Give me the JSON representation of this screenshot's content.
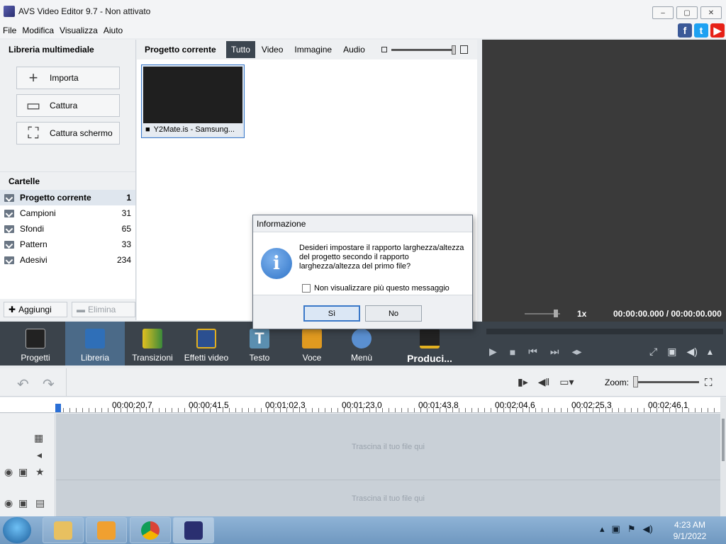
{
  "window": {
    "title": "AVS Video Editor 9.7 - Non attivato"
  },
  "menu": [
    "File",
    "Modifica",
    "Visualizza",
    "Aiuto"
  ],
  "library": {
    "title": "Libreria multimediale",
    "actions": [
      {
        "label": "Importa",
        "icon": "plus-icon"
      },
      {
        "label": "Cattura",
        "icon": "camera-icon"
      },
      {
        "label": "Cattura schermo",
        "icon": "screen-capture-icon"
      }
    ],
    "folders_title": "Cartelle",
    "folders": [
      {
        "name": "Progetto corrente",
        "count": "1"
      },
      {
        "name": "Campioni",
        "count": "31"
      },
      {
        "name": "Sfondi",
        "count": "65"
      },
      {
        "name": "Pattern",
        "count": "33"
      },
      {
        "name": "Adesivi",
        "count": "234"
      }
    ],
    "add_label": "Aggiungi",
    "remove_label": "Elimina"
  },
  "media": {
    "title": "Progetto corrente",
    "tabs": [
      "Tutto",
      "Video",
      "Immagine",
      "Audio"
    ],
    "active_tab": "Tutto",
    "file_name": "Y2Mate.is - Samsung..."
  },
  "preview": {
    "speed": "1x",
    "time": "00:00:00.000 / 00:00:00.000"
  },
  "toolbar": {
    "tools": [
      "Progetti",
      "Libreria",
      "Transizioni",
      "Effetti video",
      "Testo",
      "Voce",
      "Menù",
      "Produci..."
    ],
    "active": "Libreria"
  },
  "timeline": {
    "zoom_label": "Zoom:",
    "ruler": [
      "00:00:20.7",
      "00:00:41.5",
      "00:01:02.3",
      "00:01:23.0",
      "00:01:43.8",
      "00:02:04.6",
      "00:02:25.3",
      "00:02:46.1"
    ],
    "drop_hint": "Trascina il tuo file qui"
  },
  "dialog": {
    "title": "Informazione",
    "message": "Desideri impostare il rapporto larghezza/altezza del progetto secondo il rapporto larghezza/altezza del primo file?",
    "checkbox_label": "Non visualizzare più questo messaggio",
    "yes_label": "Sì",
    "no_label": "No"
  },
  "taskbar": {
    "time": "4:23 AM",
    "date": "9/1/2022"
  },
  "colors": {
    "accent": "#3a78c8",
    "toolbar": "#3b434b",
    "active_tool": "#4b6a88",
    "preview": "#3a3a3a"
  }
}
